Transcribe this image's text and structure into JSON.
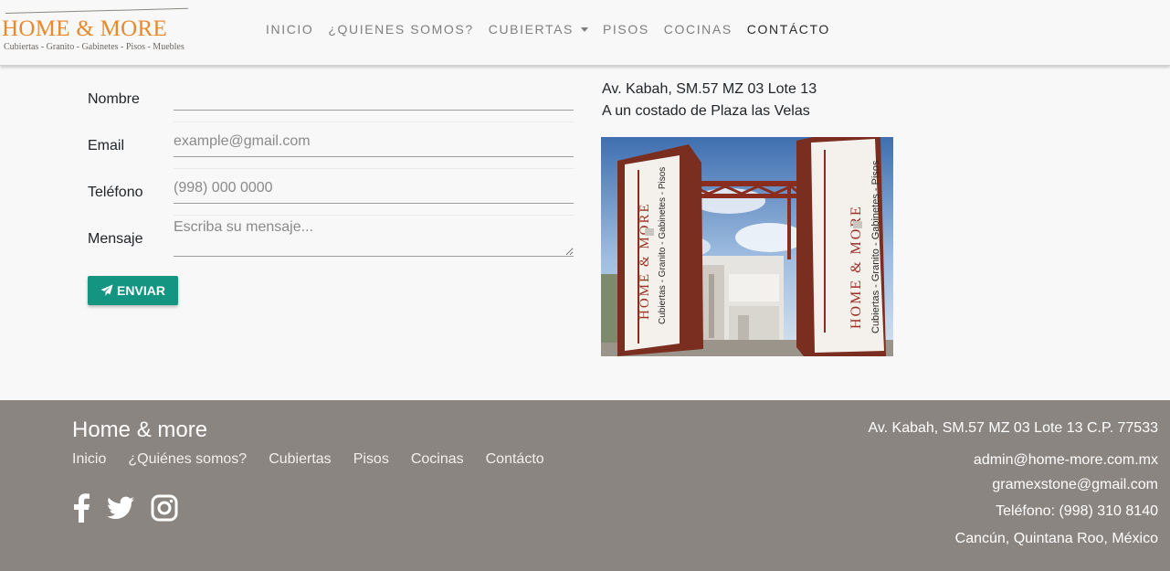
{
  "brand": {
    "title": "HOME & MORE",
    "subtitle": "Cubiertas - Granito - Gabinetes - Pisos - Muebles"
  },
  "nav": {
    "items": [
      {
        "label": "INICIO"
      },
      {
        "label": "¿QUIENES SOMOS?"
      },
      {
        "label": "CUBIERTAS"
      },
      {
        "label": "PISOS"
      },
      {
        "label": "COCINAS"
      },
      {
        "label": "CONTÁCTO"
      }
    ],
    "active": "CONTÁCTO"
  },
  "form": {
    "name": {
      "label": "Nombre",
      "value": "",
      "placeholder": ""
    },
    "email": {
      "label": "Email",
      "value": "",
      "placeholder": "example@gmail.com"
    },
    "phone": {
      "label": "Teléfono",
      "value": "",
      "placeholder": "(998) 000 0000"
    },
    "message": {
      "label": "Mensaje",
      "value": "",
      "placeholder": "Escriba su mensaje..."
    },
    "submit_label": "ENVIAR"
  },
  "address": {
    "line1": "Av. Kabah, SM.57 MZ 03 Lote 13",
    "line2": "A un costado de Plaza las Velas"
  },
  "photo": {
    "sign_left_title": "HOME & MORE",
    "sign_left_sub": "Cubiertas - Granito - Gabinetes - Pisos",
    "sign_right_title": "HOME & MORE",
    "sign_right_sub": "Cubiertas - Granito - Gabinetes - Pisos"
  },
  "footer": {
    "title": "Home & more",
    "links": [
      "Inicio",
      "¿Quiénes somos?",
      "Cubiertas",
      "Pisos",
      "Cocinas",
      "Contácto"
    ],
    "social": [
      "facebook-icon",
      "twitter-icon",
      "instagram-icon"
    ],
    "address": "Av. Kabah, SM.57 MZ 03 Lote 13 C.P. 77533",
    "email1": "admin@home-more.com.mx",
    "email2": "gramexstone@gmail.com",
    "phone": "Teléfono: (998) 310 8140",
    "city": "Cancún, Quintana Roo, México"
  },
  "colors": {
    "brand_orange": "#e8892e",
    "accent_green": "#139582",
    "footer_bg": "#8b8581",
    "nav_text": "#7f7f7f"
  }
}
